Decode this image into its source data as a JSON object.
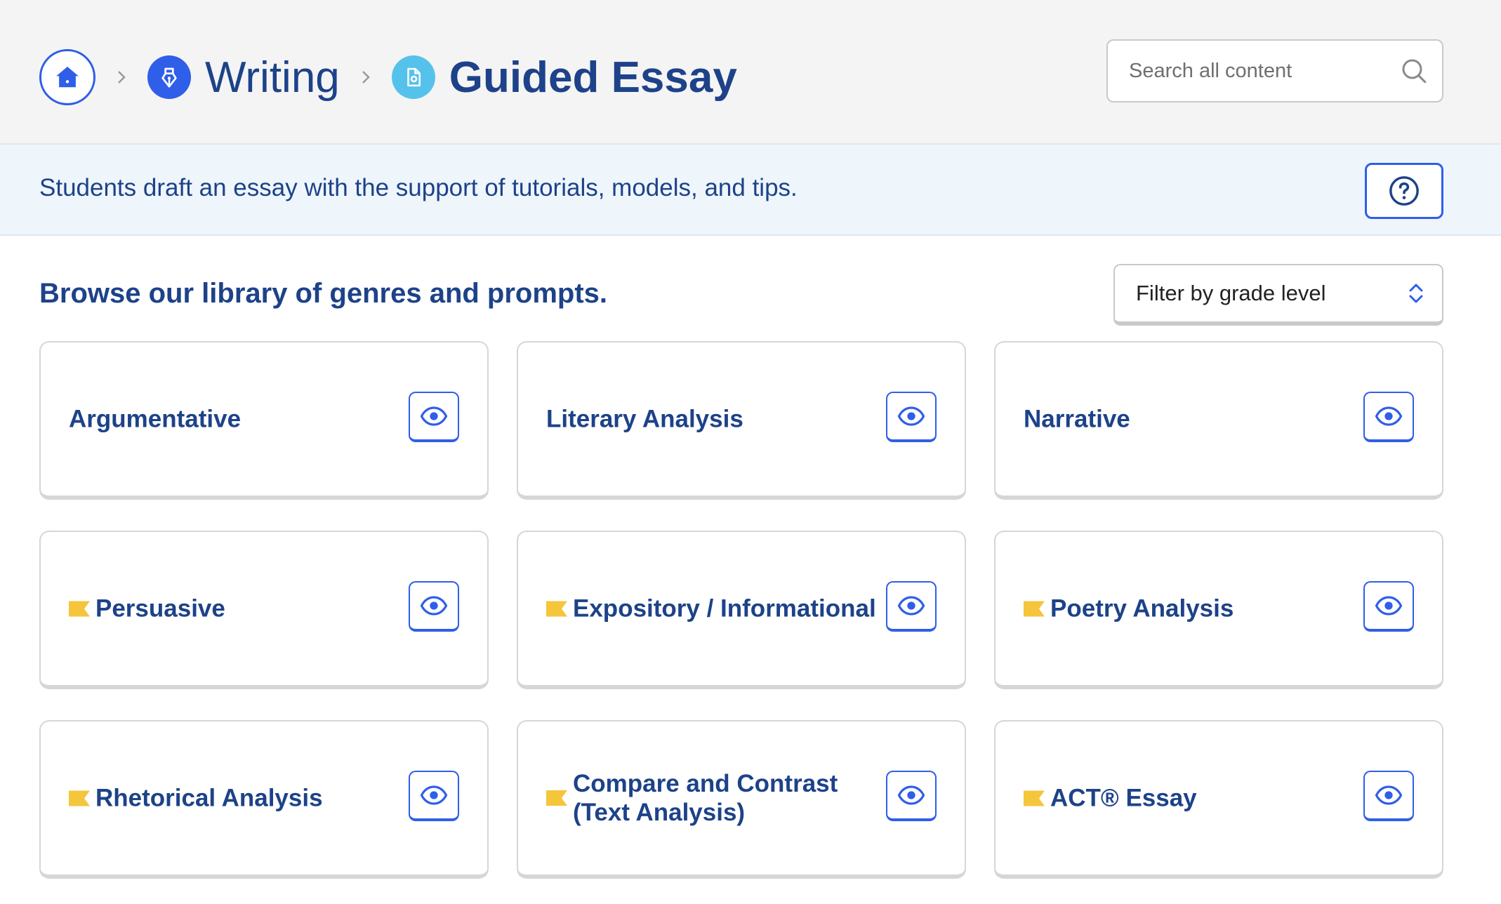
{
  "breadcrumb": {
    "home_icon": "home-icon",
    "items": [
      {
        "label": "Writing",
        "icon": "pen-nib-icon",
        "color": "#2f5ee8"
      },
      {
        "label": "Guided Essay",
        "icon": "document-icon",
        "color": "#55c2ec"
      }
    ]
  },
  "search": {
    "placeholder": "Search all content",
    "icon": "search-icon"
  },
  "banner": {
    "text": "Students draft an essay with the support of tutorials, models, and tips.",
    "help_icon": "question-circle-icon"
  },
  "library": {
    "title": "Browse our library of genres and prompts.",
    "filter_label": "Filter by grade level",
    "cards": [
      {
        "title": "Argumentative",
        "flag": false
      },
      {
        "title": "Literary Analysis",
        "flag": false
      },
      {
        "title": "Narrative",
        "flag": false
      },
      {
        "title": "Persuasive",
        "flag": true
      },
      {
        "title": "Expository / Informational",
        "flag": true
      },
      {
        "title": "Poetry Analysis",
        "flag": true
      },
      {
        "title": "Rhetorical Analysis",
        "flag": true
      },
      {
        "title": "Compare and Contrast (Text Analysis)",
        "flag": true
      },
      {
        "title": "ACT® Essay",
        "flag": true
      }
    ]
  },
  "colors": {
    "brand_blue": "#2f5ee8",
    "navy_text": "#1d4289",
    "flag_yellow": "#f5c53b",
    "banner_bg": "#eef6fc"
  }
}
